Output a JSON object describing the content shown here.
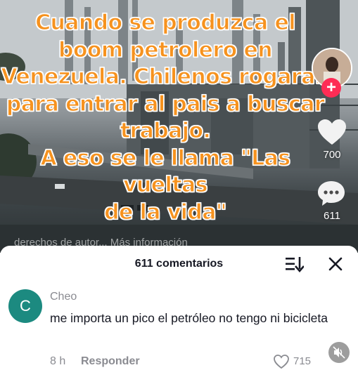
{
  "video": {
    "caption": "Cuando se produzca el\nboom petrolero en\nVenezuela. Chilenos rogaran\npara entrar al pais a buscar\ntrabajo.\nA eso se le llama \"Las vueltas\nde la vida\"",
    "likes": "700",
    "comments": "611",
    "description_peek": "derechos de autor... Más información"
  },
  "comments_sheet": {
    "title": "611 comentarios",
    "comment": {
      "avatar_letter": "C",
      "avatar_color": "#1c8a80",
      "username": "Cheo",
      "text": "me importa un pico el petróleo no tengo ni bicicleta",
      "time": "8 h",
      "reply_label": "Responder",
      "likes": "715"
    }
  },
  "colors": {
    "caption_fill": "#f6921e",
    "follow_accent": "#fe2c55"
  },
  "icons": [
    "follow-plus-icon",
    "heart-icon",
    "comment-bubble-icon",
    "sort-icon",
    "close-icon",
    "heart-outline-icon",
    "mute-icon"
  ]
}
